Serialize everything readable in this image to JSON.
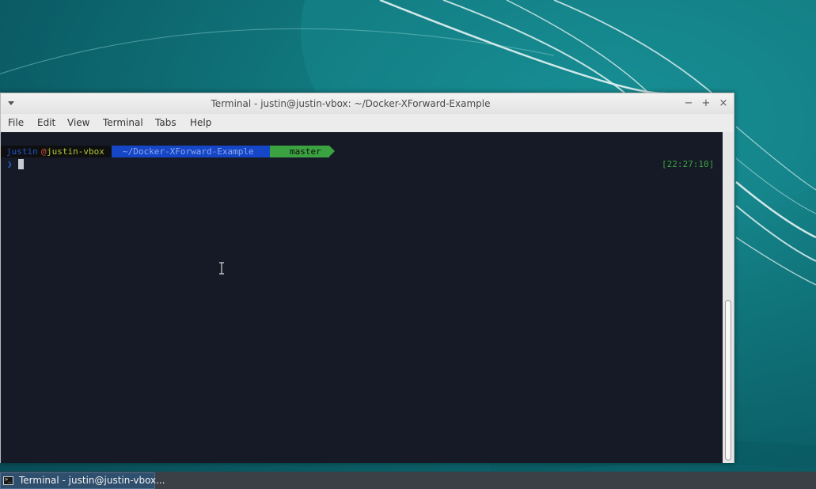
{
  "window": {
    "title": "Terminal - justin@justin-vbox: ~/Docker-XForward-Example",
    "controls": {
      "minimize": "−",
      "maximize": "+",
      "close": "×"
    }
  },
  "menubar": {
    "items": [
      "File",
      "Edit",
      "View",
      "Terminal",
      "Tabs",
      "Help"
    ]
  },
  "terminal": {
    "prompt": {
      "user": "justin",
      "at": "@",
      "host": "justin-vbox",
      "path": "~/Docker-XForward-Example",
      "git_icon": "⹿",
      "branch": "master",
      "chevron": "❯"
    },
    "clock": "[22:27:10]",
    "colors": {
      "background": "#151a26",
      "user_segment": "#0f0f10",
      "path_segment": "#1546c8",
      "git_segment": "#3aa240"
    }
  },
  "taskbar": {
    "task_label": "Terminal - justin@justin-vbox...",
    "task_icon": "terminal-icon"
  }
}
